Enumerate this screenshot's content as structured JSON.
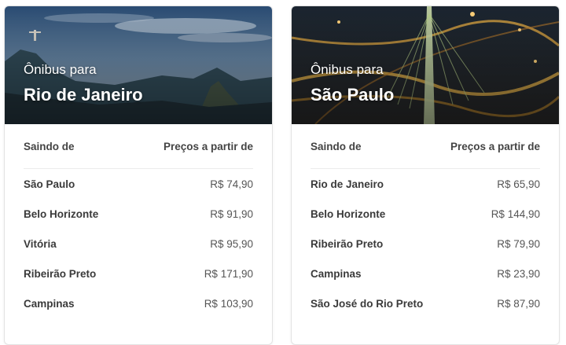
{
  "cards": [
    {
      "subtitle": "Ônibus para",
      "city": "Rio de Janeiro",
      "header_origin": "Saindo de",
      "header_price": "Preços a partir de",
      "rows": [
        {
          "origin": "São Paulo",
          "price": "R$ 74,90"
        },
        {
          "origin": "Belo Horizonte",
          "price": "R$ 91,90"
        },
        {
          "origin": "Vitória",
          "price": "R$ 95,90"
        },
        {
          "origin": "Ribeirão Preto",
          "price": "R$ 171,90"
        },
        {
          "origin": "Campinas",
          "price": "R$ 103,90"
        }
      ]
    },
    {
      "subtitle": "Ônibus para",
      "city": "São Paulo",
      "header_origin": "Saindo de",
      "header_price": "Preços a partir de",
      "rows": [
        {
          "origin": "Rio de Janeiro",
          "price": "R$ 65,90"
        },
        {
          "origin": "Belo Horizonte",
          "price": "R$ 144,90"
        },
        {
          "origin": "Ribeirão Preto",
          "price": "R$ 79,90"
        },
        {
          "origin": "Campinas",
          "price": "R$ 23,90"
        },
        {
          "origin": "São José do Rio Preto",
          "price": "R$ 87,90"
        }
      ]
    }
  ]
}
